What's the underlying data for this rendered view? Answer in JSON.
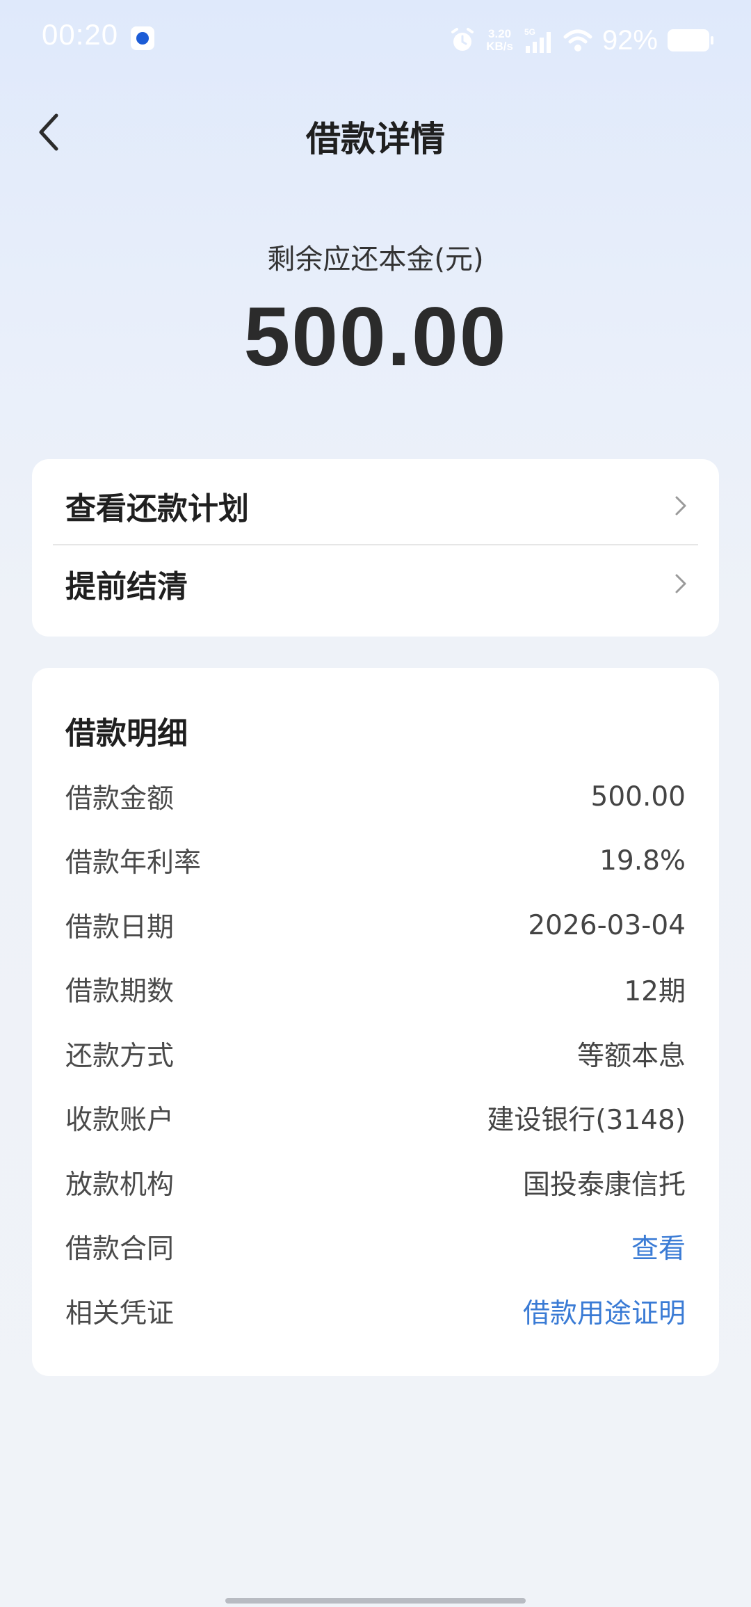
{
  "status_bar": {
    "time": "00:20",
    "speed_value": "3.20",
    "speed_unit": "KB/s",
    "network": "5G",
    "battery": "92%"
  },
  "nav": {
    "title": "借款详情"
  },
  "summary": {
    "label": "剩余应还本金(元)",
    "amount": "500.00"
  },
  "actions": [
    {
      "label": "查看还款计划"
    },
    {
      "label": "提前结清"
    }
  ],
  "details": {
    "title": "借款明细",
    "rows": [
      {
        "key": "借款金额",
        "value": "500.00"
      },
      {
        "key": "借款年利率",
        "value": "19.8%"
      },
      {
        "key": "借款日期",
        "value": "2026-03-04"
      },
      {
        "key": "借款期数",
        "value": "12期"
      },
      {
        "key": "还款方式",
        "value": "等额本息"
      },
      {
        "key": "收款账户",
        "value": "建设银行(3148)"
      },
      {
        "key": "放款机构",
        "value": "国投泰康信托"
      },
      {
        "key": "借款合同",
        "value": "查看"
      },
      {
        "key": "相关凭证",
        "value": "借款用途证明"
      }
    ]
  },
  "colors": {
    "link": "#3a7bd5",
    "card": "#ffffff",
    "background": "#eef2f8"
  }
}
